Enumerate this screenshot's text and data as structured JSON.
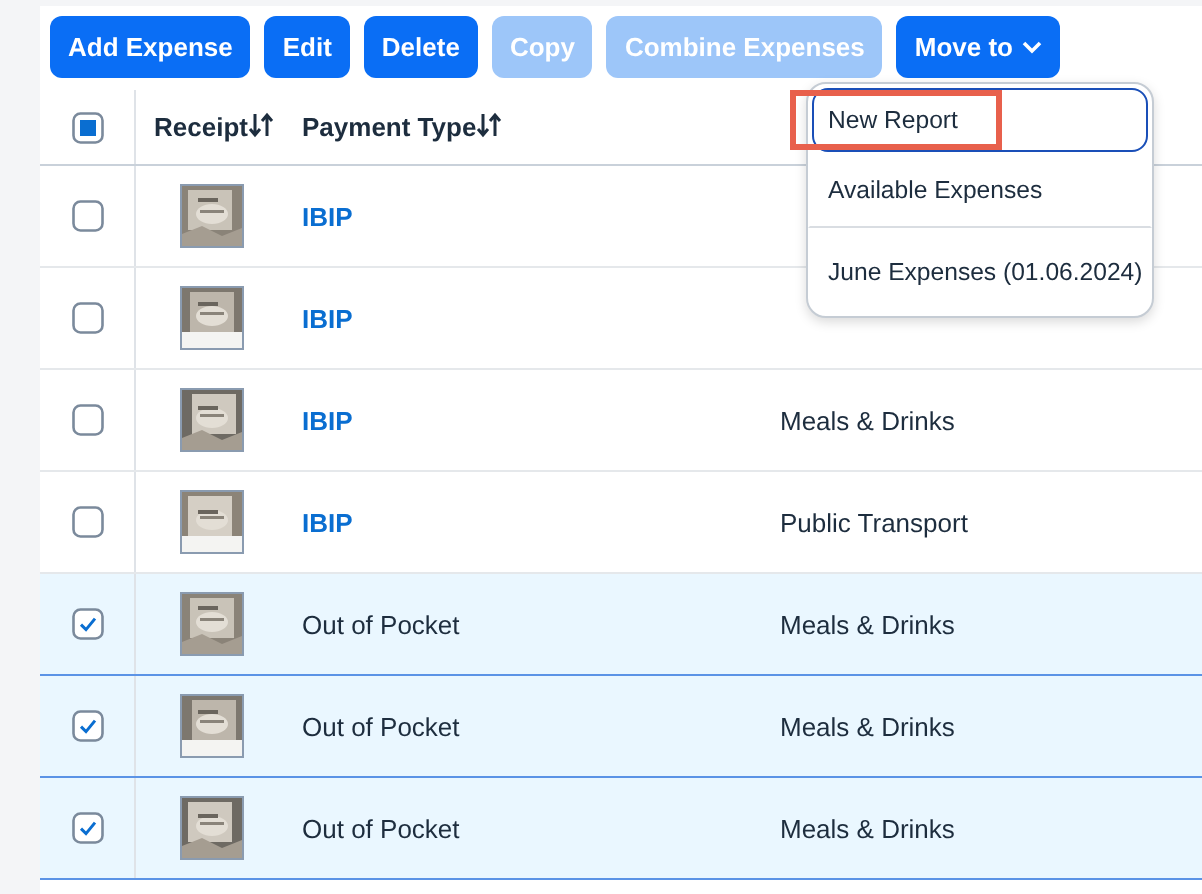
{
  "toolbar": {
    "buttons": [
      {
        "label": "Add Expense",
        "disabled": false,
        "menu": false
      },
      {
        "label": "Edit",
        "disabled": false,
        "menu": false
      },
      {
        "label": "Delete",
        "disabled": false,
        "menu": false
      },
      {
        "label": "Copy",
        "disabled": true,
        "menu": false
      },
      {
        "label": "Combine Expenses",
        "disabled": true,
        "menu": false
      },
      {
        "label": "Move to",
        "disabled": false,
        "menu": true
      }
    ]
  },
  "table": {
    "select_all": {
      "checked": false,
      "partial": true
    },
    "columns": [
      {
        "label": "Receipt",
        "sortable": true
      },
      {
        "label": "Payment Type",
        "sortable": true
      }
    ],
    "rows": [
      {
        "selected": false,
        "payment_type": "IBIP",
        "link": true
      },
      {
        "selected": false,
        "payment_type": "IBIP",
        "link": true
      },
      {
        "selected": false,
        "payment_type": "IBIP",
        "link": true,
        "expense_type": "Meals & Drinks"
      },
      {
        "selected": false,
        "payment_type": "IBIP",
        "link": true,
        "expense_type": "Public Transport"
      },
      {
        "selected": true,
        "payment_type": "Out of Pocket",
        "link": false,
        "expense_type": "Meals & Drinks"
      },
      {
        "selected": true,
        "payment_type": "Out of Pocket",
        "link": false,
        "expense_type": "Meals & Drinks"
      },
      {
        "selected": true,
        "payment_type": "Out of Pocket",
        "link": false,
        "expense_type": "Meals & Drinks"
      }
    ]
  },
  "move_menu": {
    "items": [
      {
        "label": "New Report",
        "focused": true,
        "annotated": true,
        "divider_after": false
      },
      {
        "label": "Available Expenses",
        "focused": false,
        "annotated": false,
        "divider_after": true
      },
      {
        "label": "June Expenses (01.06.2024)",
        "focused": false,
        "annotated": false,
        "divider_after": false
      }
    ]
  }
}
